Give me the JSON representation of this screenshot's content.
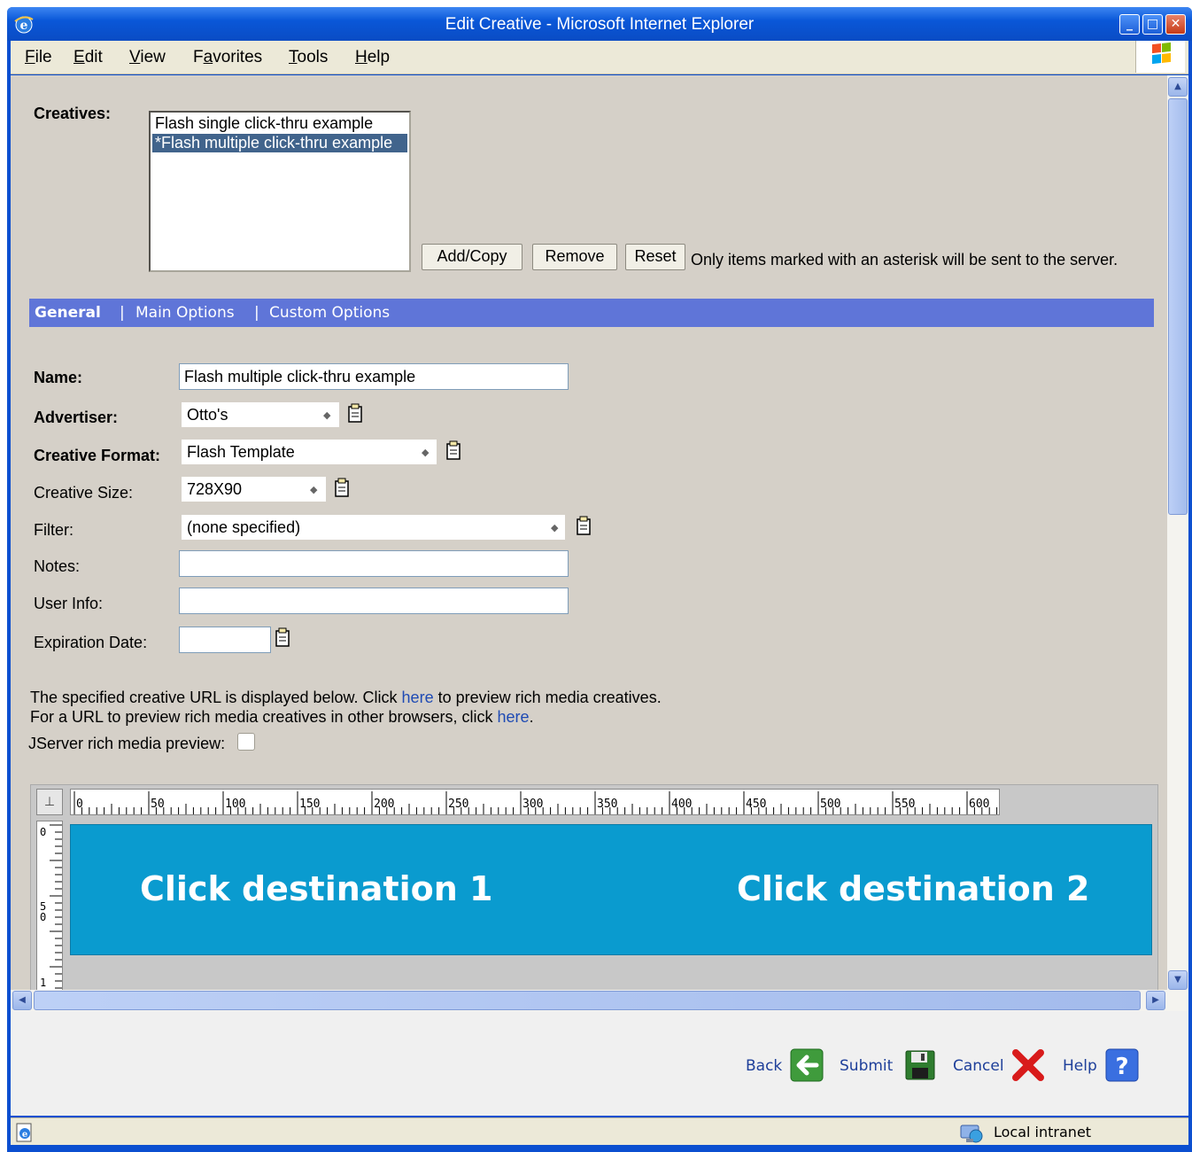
{
  "window": {
    "title": "Edit Creative - Microsoft Internet Explorer",
    "minimize": "_",
    "maximize": "□",
    "close": "✕"
  },
  "menu": [
    {
      "label": "File",
      "accel": "F",
      "rest": "ile"
    },
    {
      "label": "Edit",
      "accel": "E",
      "rest": "dit"
    },
    {
      "label": "View",
      "accel": "V",
      "rest": "iew"
    },
    {
      "label": "Favorites",
      "accel": "a",
      "pre": "F",
      "rest": "vorites"
    },
    {
      "label": "Tools",
      "accel": "T",
      "rest": "ools"
    },
    {
      "label": "Help",
      "accel": "H",
      "rest": "elp"
    }
  ],
  "creatives": {
    "label": "Creatives:",
    "items": [
      "Flash single click-thru example",
      "*Flash multiple click-thru example"
    ],
    "selected_index": 1,
    "buttons": {
      "add": "Add/Copy",
      "remove": "Remove",
      "reset": "Reset"
    },
    "note": "Only items marked with an asterisk will be sent to the server."
  },
  "tabs": {
    "general": "General",
    "sep": "|",
    "main": "Main Options",
    "custom": "Custom Options"
  },
  "form": {
    "name": {
      "label": "Name:",
      "value": "Flash multiple click-thru example"
    },
    "advertiser": {
      "label": "Advertiser:",
      "value": "Otto's"
    },
    "format": {
      "label": "Creative Format:",
      "value": "Flash Template"
    },
    "size": {
      "label": "Creative Size:",
      "value": "728X90"
    },
    "filter": {
      "label": "Filter:",
      "value": "(none specified)"
    },
    "notes": {
      "label": "Notes:",
      "value": ""
    },
    "userinfo": {
      "label": "User Info:",
      "value": ""
    },
    "expiration": {
      "label": "Expiration Date:",
      "value": ""
    }
  },
  "preview_info": {
    "line1_pre": "The specified creative URL is displayed below. Click",
    "line1_link": "here",
    "line1_post": "to preview rich media creatives.",
    "line2_pre": "For a URL to preview rich media creatives in other browsers, click",
    "line2_link": "here",
    "line2_post": ".",
    "jserver_label": "JServer rich media preview:"
  },
  "ruler": {
    "h_labels": [
      "0",
      "50",
      "100",
      "150",
      "200",
      "250",
      "300",
      "350",
      "400",
      "450",
      "500",
      "550",
      "600"
    ],
    "v_labels": [
      "0",
      "5\n0",
      "1"
    ]
  },
  "banner": {
    "dest1": "Click destination 1",
    "dest2": "Click destination 2"
  },
  "actions": {
    "back": "Back",
    "submit": "Submit",
    "cancel": "Cancel",
    "help": "Help"
  },
  "status": {
    "zone": "Local intranet"
  },
  "colors": {
    "tabbar": "#5f75d8",
    "banner": "#0a9bcf",
    "link": "#1e4ab4",
    "selection": "#41648c"
  }
}
